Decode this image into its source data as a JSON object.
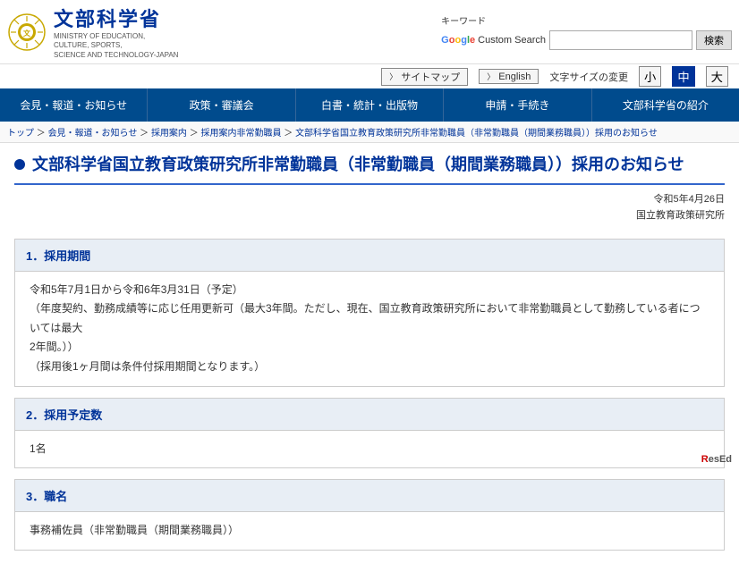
{
  "header": {
    "logo_ministry": "文部科学省",
    "logo_subtitle_line1": "MINISTRY OF EDUCATION,",
    "logo_subtitle_line2": "CULTURE, SPORTS,",
    "logo_subtitle_line3": "SCIENCE AND TECHNOLOGY-JAPAN",
    "sitemap_label": "サイトマップ",
    "english_label": "English",
    "font_size_label": "文字サイズの変更",
    "font_small": "小",
    "font_medium": "中",
    "font_large": "大",
    "keyword_label": "キーワード",
    "google_label": "Custom Search",
    "search_placeholder": "",
    "search_btn": "検索"
  },
  "nav": {
    "items": [
      {
        "label": "会見・報道・お知らせ"
      },
      {
        "label": "政策・審議会"
      },
      {
        "label": "白書・統計・出版物"
      },
      {
        "label": "申請・手続き"
      },
      {
        "label": "文部科学省の紹介"
      }
    ]
  },
  "breadcrumb": {
    "items": [
      {
        "label": "トップ"
      },
      {
        "label": "会見・報道・お知らせ"
      },
      {
        "label": "採用案内"
      },
      {
        "label": "採用案内非常勤職員"
      },
      {
        "label": "文部科学省国立教育政策研究所非常勤職員（非常勤職員（期間業務職員））採用のお知らせ"
      }
    ],
    "separator": " ＞ "
  },
  "page_title": "文部科学省国立教育政策研究所非常勤職員（非常勤職員（期間業務職員））採用のお知らせ",
  "meta": {
    "date": "令和5年4月26日",
    "org": "国立教育政策研究所"
  },
  "sections": [
    {
      "number": "1",
      "title": "採用期間",
      "body_lines": [
        "令和5年7月1日から令和6年3月31日（予定）",
        "（年度契約、勤務成績等に応じ任用更新可（最大3年間。ただし、現在、国立教育政策研究所において非常勤職員として勤務している者については最大",
        "2年間。））",
        "（採用後1ヶ月間は条件付採用期間となります。）"
      ]
    },
    {
      "number": "2",
      "title": "採用予定数",
      "body_lines": [
        "1名"
      ]
    },
    {
      "number": "3",
      "title": "職名",
      "body_lines": [
        "事務補佐員（非常勤職員（期間業務職員））"
      ]
    }
  ],
  "watermark": {
    "logo": "ResEd"
  }
}
